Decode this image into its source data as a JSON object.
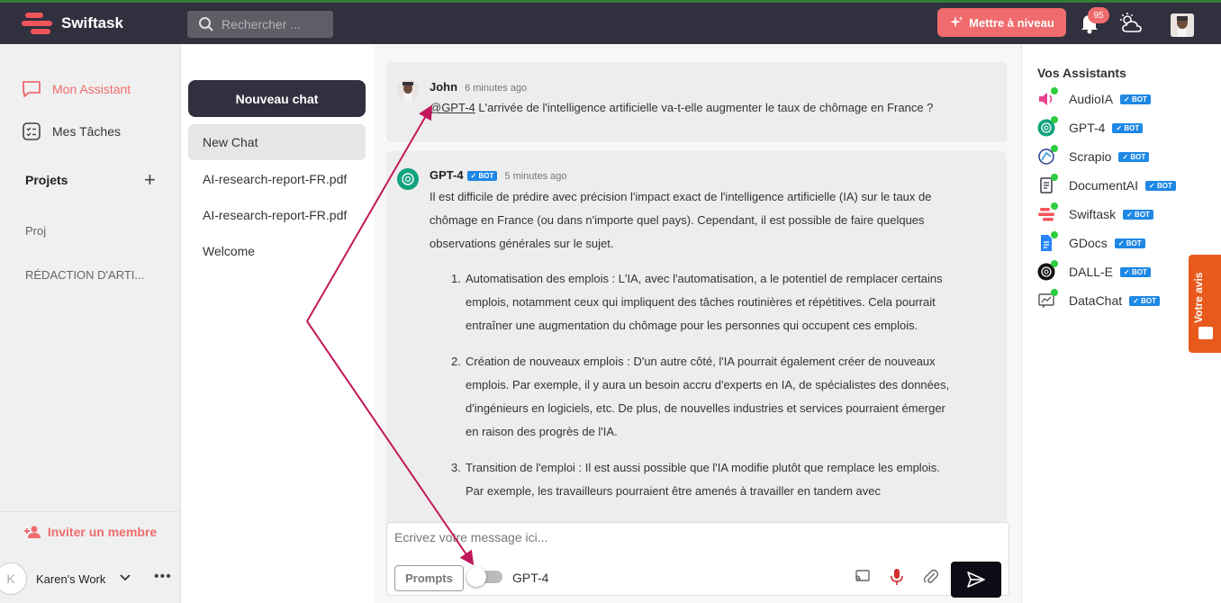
{
  "topbar": {
    "brand": "Swiftask",
    "search_placeholder": "Rechercher ...",
    "upgrade_label": "Mettre à niveau",
    "notification_count": "95"
  },
  "leftnav": {
    "items": [
      {
        "label": "Mon Assistant"
      },
      {
        "label": "Mes Tâches"
      }
    ],
    "projects_title": "Projets",
    "projects": [
      {
        "label": "Proj"
      },
      {
        "label": "RÉDACTION D'ARTI..."
      }
    ],
    "invite_label": "Inviter un membre",
    "workspace_initial": "K",
    "workspace_name": "Karen's Work"
  },
  "chatlist": {
    "new_chat_label": "Nouveau chat",
    "chats": [
      {
        "label": "New Chat"
      },
      {
        "label": "AI-research-report-FR.pdf"
      },
      {
        "label": "AI-research-report-FR.pdf"
      },
      {
        "label": "Welcome"
      }
    ]
  },
  "messages": {
    "user": {
      "name": "John",
      "time": "6 minutes ago",
      "mention": "@GPT-4",
      "text": " L'arrivée de l'intelligence artificielle va-t-elle augmenter le taux de chômage en France ?"
    },
    "bot": {
      "name": "GPT-4",
      "badge": "BOT",
      "time": "5 minutes ago",
      "intro_1": "Il est difficile de prédire avec précision l'impact exact de l'intelligence artificielle (IA) sur le taux de",
      "intro_2": "chômage en France (ou dans n'importe quel pays). Cependant, il est possible de faire quelques",
      "intro_3": "observations générales sur le sujet.",
      "points": [
        {
          "num": "1.",
          "text": "Automatisation des emplois : L'IA, avec l'automatisation, a le potentiel de remplacer certains emplois, notamment ceux qui impliquent des tâches routinières et répétitives. Cela pourrait entraîner une augmentation du chômage pour les personnes qui occupent ces emplois."
        },
        {
          "num": "2.",
          "text": "Création de nouveaux emplois : D'un autre côté, l'IA pourrait également créer de nouveaux emplois. Par exemple, il y aura un besoin accru d'experts en IA, de spécialistes des données, d'ingénieurs en logiciels, etc. De plus, de nouvelles industries et services pourraient émerger en raison des progrès de l'IA."
        },
        {
          "num": "3.",
          "text": "Transition de l'emploi : Il est aussi possible que l'IA modifie plutôt que remplace les emplois. Par exemple, les travailleurs pourraient être amenés à travailler en tandem avec"
        }
      ]
    }
  },
  "composer": {
    "placeholder": "Ecrivez votre message ici...",
    "prompts_label": "Prompts",
    "model_label": "GPT-4"
  },
  "rightpanel": {
    "title": "Vos Assistants",
    "badge": "BOT",
    "assistants": [
      {
        "name": "AudioIA",
        "icon": "speaker-icon",
        "color": "#e84393"
      },
      {
        "name": "GPT-4",
        "icon": "openai-icon",
        "color": "#10a37f"
      },
      {
        "name": "Scrapio",
        "icon": "scrapio-icon",
        "color": "#2c3e8f"
      },
      {
        "name": "DocumentAI",
        "icon": "document-icon",
        "color": "#3a3a4a"
      },
      {
        "name": "Swiftask",
        "icon": "swiftask-icon",
        "color": "#f2545b"
      },
      {
        "name": "GDocs",
        "icon": "gdocs-icon",
        "color": "#2684fc"
      },
      {
        "name": "DALL-E",
        "icon": "openai-icon",
        "color": "#111111"
      },
      {
        "name": "DataChat",
        "icon": "datachat-icon",
        "color": "#555555"
      }
    ]
  },
  "feedback_tab": {
    "label": "Votre avis"
  },
  "colors": {
    "accent": "#f06b6d",
    "dark": "#30303f",
    "arrow": "#c2185b"
  }
}
